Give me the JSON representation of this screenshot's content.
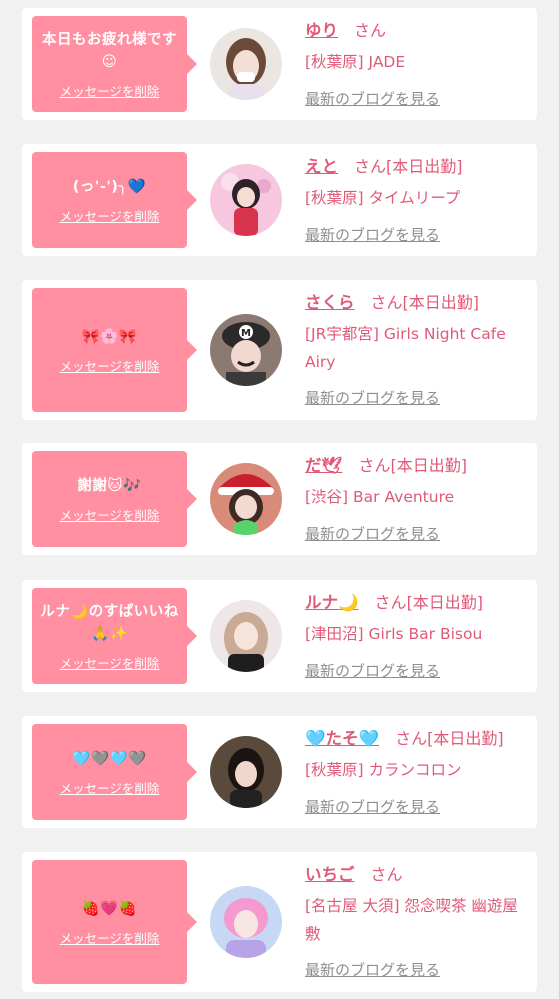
{
  "delete_label": "メッセージを削除",
  "blog_label": "最新のブログを見る",
  "honorific": "さん",
  "colors": {
    "bubble": "#ff8fa1",
    "name_pink": "#e05a78",
    "link_gray": "#8e8e8e",
    "page_bg": "#f1f1f1"
  },
  "cards": [
    {
      "message": "本日もお疲れ様です☺",
      "name": "ゆり",
      "status": "",
      "shop": "[秋葉原] JADE"
    },
    {
      "message": "(っ'-')╮💙",
      "name": "えと",
      "status": "[本日出勤]",
      "shop": "[秋葉原] タイムリープ"
    },
    {
      "message": "🎀🌸🎀",
      "name": "さくら",
      "status": "[本日出勤]",
      "shop": "[JR宇都宮] Girls Night Cafe Airy"
    },
    {
      "message": "謝謝🐱🎶",
      "name": "だ🕊",
      "status": "[本日出勤]",
      "shop": "[渋谷] Bar Aventure"
    },
    {
      "message": "ルナ🌙のすぱいいね🙏✨",
      "name": "ルナ🌙",
      "status": "[本日出勤]",
      "shop": "[津田沼] Girls Bar Bisou"
    },
    {
      "message": "🩵🩶🩵🩶",
      "name": "🩵たそ🩵",
      "status": "[本日出勤]",
      "shop": "[秋葉原] カランコロン"
    },
    {
      "message": "🍓💗🍓",
      "name": "いちご",
      "status": "",
      "shop": "[名古屋 大須] 怨念喫茶 幽遊屋敷"
    }
  ]
}
